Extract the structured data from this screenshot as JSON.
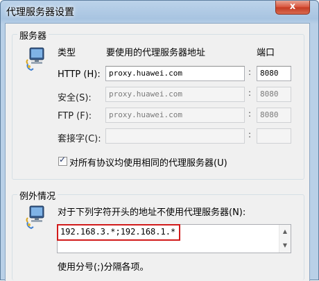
{
  "window": {
    "title": "代理服务器设置",
    "close_label": "x"
  },
  "servers": {
    "group_label": "服务器",
    "col_type": "类型",
    "col_address": "要使用的代理服务器地址",
    "col_port": "端口",
    "rows": [
      {
        "label": "HTTP (H):",
        "address": "proxy.huawei.com",
        "port": "8080",
        "enabled": true
      },
      {
        "label": "安全(S):",
        "address": "proxy.huawei.com",
        "port": "8080",
        "enabled": false
      },
      {
        "label": "FTP (F):",
        "address": "proxy.huawei.com",
        "port": "8080",
        "enabled": false
      },
      {
        "label": "套接字(C):",
        "address": "",
        "port": "",
        "enabled": false
      }
    ],
    "colon": ":",
    "same_proxy_label": "对所有协议均使用相同的代理服务器(U)",
    "same_proxy_checked": true
  },
  "exceptions": {
    "group_label": "例外情况",
    "description": "对于下列字符开头的地址不使用代理服务器(N):",
    "value": "192.168.3.*;192.168.1.*",
    "hint": "使用分号(;)分隔各项。"
  },
  "icons": {
    "server_icon": "network-computer-icon",
    "exception_icon": "network-computer-icon"
  },
  "colors": {
    "highlight_border": "#d11a1a",
    "close_button": "#c43b22"
  }
}
